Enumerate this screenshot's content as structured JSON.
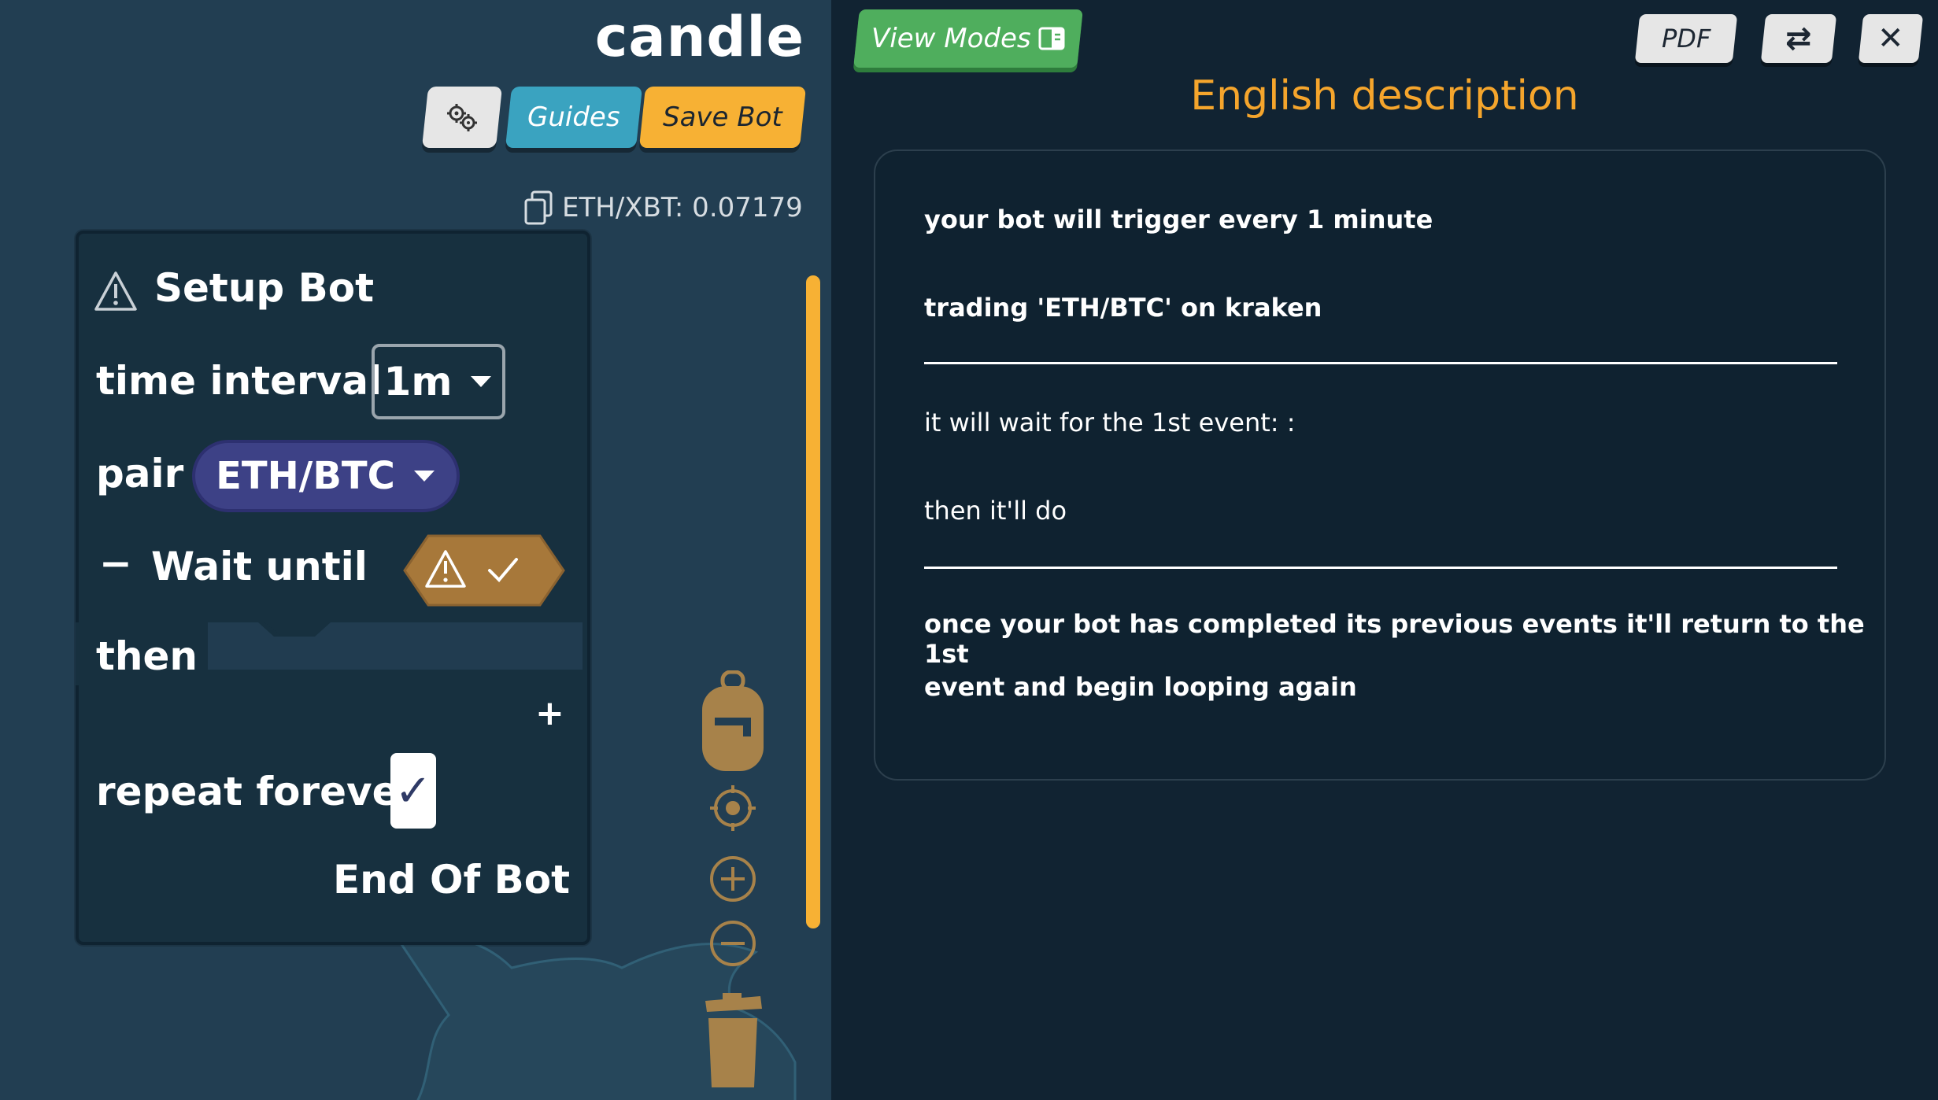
{
  "header": {
    "bot_name": "candle",
    "guides_label": "Guides",
    "save_label": "Save Bot",
    "price_readout": "ETH/XBT: 0.07179"
  },
  "setup_block": {
    "title": "Setup Bot",
    "interval_label": "time interval",
    "interval_value": "1m",
    "pair_label": "pair",
    "pair_value": "ETH/BTC",
    "collapse_symbol": "−",
    "wait_label": "Wait until",
    "then_label": "then",
    "add_symbol": "+",
    "repeat_label": "repeat forever",
    "repeat_checked": "✓",
    "end_label": "End Of Bot"
  },
  "toolbar": {
    "view_modes_label": "View Modes",
    "pdf_label": "PDF",
    "swap_symbol": "⇄",
    "close_symbol": "✕"
  },
  "description": {
    "title": "English description",
    "line1": "your bot will trigger every 1 minute",
    "line2": "trading 'ETH/BTC' on kraken",
    "line3": "it will wait for the 1st event: :",
    "line4": "then it'll do",
    "line5": "once your bot has completed its previous events it'll return to the 1st",
    "line6": "event and begin looping again"
  },
  "colors": {
    "accent_orange": "#f7b134",
    "guides_blue": "#3aa3c0",
    "view_modes_green": "#4fae5d",
    "pair_purple": "#3d4186",
    "condition_brown": "#a7783a"
  },
  "icons": {
    "gear": "gears-icon",
    "copy": "copy-icon",
    "warning": "warning-triangle-icon",
    "backpack": "backpack-icon",
    "recenter": "crosshair-icon",
    "zoom_in": "zoom-in-icon",
    "zoom_out": "zoom-out-icon",
    "trash": "trash-icon",
    "view_modes": "book-icon"
  }
}
